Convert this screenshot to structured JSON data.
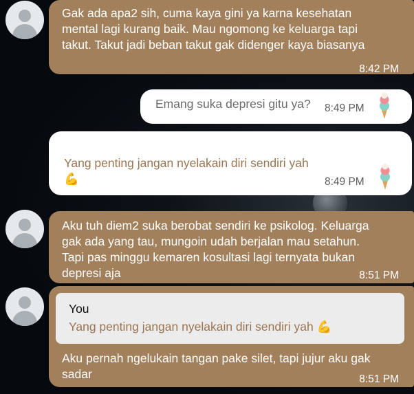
{
  "messages": [
    {
      "text": "Gak ada apa2 sih, cuma kaya gini ya karna kesehatan\nmental lagi kurang baik. Mau ngomong ke keluarga tapi\ntakut. Takut jadi beban takut gak didenger kaya biasanya",
      "time": "8:42 PM"
    },
    {
      "text": "Emang suka depresi gitu ya?",
      "time": "8:49 PM",
      "sticker": "ice-cream-icon"
    },
    {
      "text": "Yang penting jangan nyelakain diri sendiri yah",
      "emoji": "💪",
      "time": "8:49 PM",
      "sticker": "ice-cream-icon"
    },
    {
      "text": "Aku tuh diem2 suka berobat sendiri ke psikolog. Keluarga\ngak ada yang tau, mungoin udah berjalan mau setahun.\nTapi pas minggu kemaren kosultasi lagi ternyata bukan\ndepresi aja",
      "time": "8:51 PM"
    },
    {
      "quote": {
        "sender": "You",
        "text": "Yang penting jangan nyelakain diri sendiri yah",
        "emoji": "💪"
      },
      "text": "Aku pernah ngelukain tangan pake silet, tapi jujur aku gak\nsadar",
      "time": "8:51 PM"
    }
  ],
  "colors": {
    "incoming_bubble": "#a2805c",
    "outgoing_bubble": "#ffffff",
    "quote_background": "#ececec",
    "quote_text": "#9a7552"
  }
}
